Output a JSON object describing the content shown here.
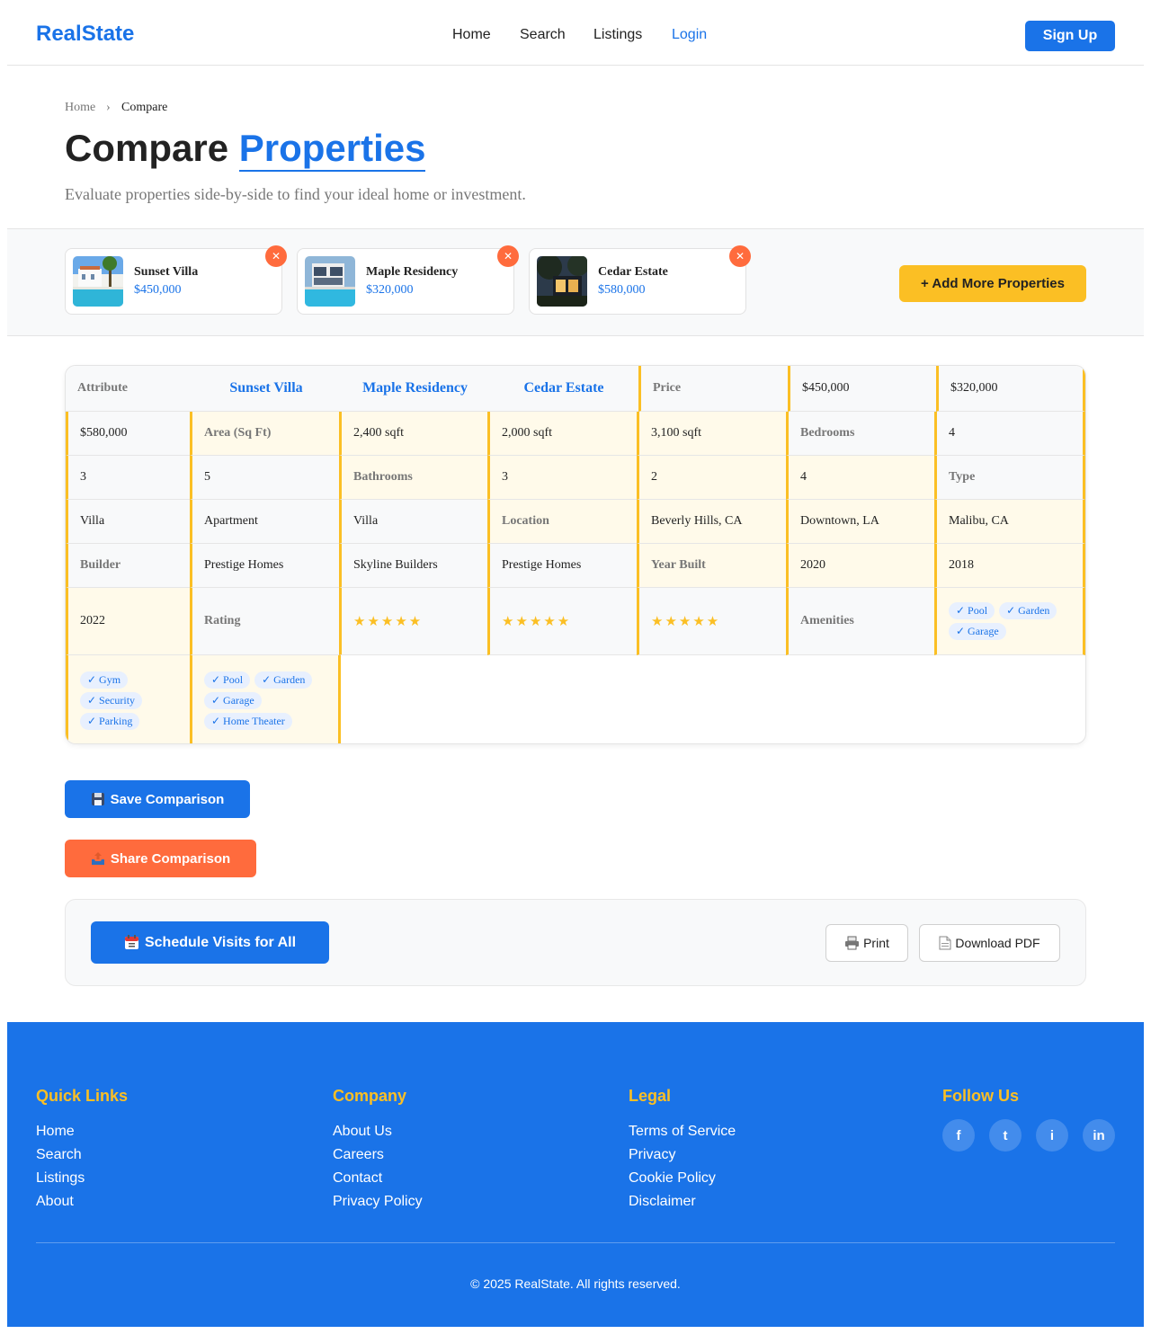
{
  "header": {
    "logo": "RealState",
    "nav": [
      "Home",
      "Search",
      "Listings",
      "Login"
    ],
    "signup": "Sign Up"
  },
  "breadcrumb": {
    "home": "Home",
    "sep": "›",
    "current": "Compare"
  },
  "hero": {
    "title_a": "Compare",
    "title_b": "Properties",
    "subtitle": "Evaluate properties side-by-side to find your ideal home or investment."
  },
  "selected": [
    {
      "name": "Sunset Villa",
      "price": "$450,000"
    },
    {
      "name": "Maple Residency",
      "price": "$320,000"
    },
    {
      "name": "Cedar Estate",
      "price": "$580,000"
    }
  ],
  "remove_label": "✕",
  "add_more": "+ Add More Properties",
  "table": {
    "header": [
      "Attribute",
      "Sunset Villa",
      "Maple Residency",
      "Cedar Estate",
      "Price",
      "$450,000",
      "$320,000"
    ],
    "row1": [
      "$580,000",
      "Area (Sq Ft)",
      "2,400 sqft",
      "2,000 sqft",
      "3,100 sqft",
      "Bedrooms",
      "4"
    ],
    "row2": [
      "3",
      "5",
      "Bathrooms",
      "3",
      "2",
      "4",
      "Type"
    ],
    "row3": [
      "Villa",
      "Apartment",
      "Villa",
      "Location",
      "Beverly Hills, CA",
      "Downtown, LA",
      "Malibu, CA"
    ],
    "row4": [
      "Builder",
      "Prestige Homes",
      "Skyline Builders",
      "Prestige Homes",
      "Year Built",
      "2020",
      "2018"
    ],
    "row5": [
      "2022",
      "Rating",
      "★★★★★",
      "★★★★★",
      "★★★★★",
      "Amenities"
    ],
    "amen_a": [
      "✓ Pool",
      "✓ Garden",
      "✓ Garage"
    ],
    "amen_b": [
      "✓ Gym",
      "✓ Security",
      "✓ Parking"
    ],
    "amen_c": [
      "✓ Pool",
      "✓ Garden",
      "✓ Garage",
      "✓ Home Theater"
    ]
  },
  "actions": {
    "save": "Save Comparison",
    "share": "Share Comparison",
    "schedule": "Schedule Visits for All",
    "print": "Print",
    "pdf": "Download PDF"
  },
  "footer": {
    "quick": {
      "title": "Quick Links",
      "links": [
        "Home",
        "Search",
        "Listings",
        "About"
      ]
    },
    "company": {
      "title": "Company",
      "links": [
        "About Us",
        "Careers",
        "Contact",
        "Privacy Policy"
      ]
    },
    "legal": {
      "title": "Legal",
      "links": [
        "Terms of Service",
        "Privacy",
        "Cookie Policy",
        "Disclaimer"
      ]
    },
    "follow": {
      "title": "Follow Us",
      "icons": [
        "f",
        "t",
        "i",
        "in"
      ]
    },
    "copyright": "© 2025 RealState. All rights reserved."
  },
  "colors": {
    "primary": "#1a73e8",
    "accent": "#fbbf24",
    "danger": "#ff6b3d"
  }
}
